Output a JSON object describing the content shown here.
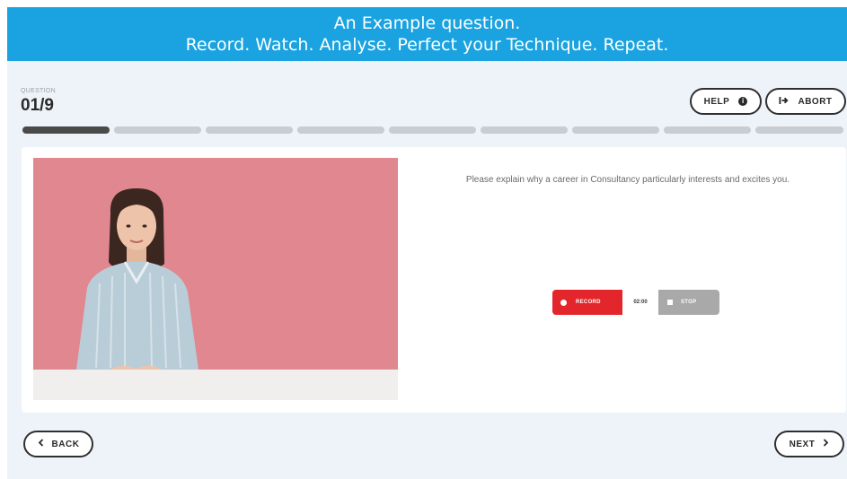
{
  "banner": {
    "line1": "An Example question.",
    "line2": "Record. Watch. Analyse. Perfect your Technique. Repeat."
  },
  "header": {
    "question_label": "QUESTION",
    "question_counter": "01/9",
    "help_label": "HELP",
    "abort_label": "ABORT"
  },
  "progress": {
    "total_segments": 9,
    "current": 1
  },
  "question": {
    "text": "Please explain why a career in Consultancy particularly interests and excites you."
  },
  "recorder": {
    "record_label": "RECORD",
    "timer_value": "02:00",
    "stop_label": "STOP"
  },
  "footer": {
    "back_label": "BACK",
    "next_label": "NEXT"
  },
  "icons": {
    "help": "info-circle-icon",
    "abort": "exit-icon",
    "back": "chevron-left-icon",
    "next": "chevron-right-icon",
    "record": "record-dot-icon",
    "stop": "stop-square-icon"
  },
  "colors": {
    "banner": "#1aa3e0",
    "record": "#e3262b",
    "stop": "#a9a9a9",
    "progress_active": "#4a4a4a",
    "progress_inactive": "#c9ccd1"
  }
}
